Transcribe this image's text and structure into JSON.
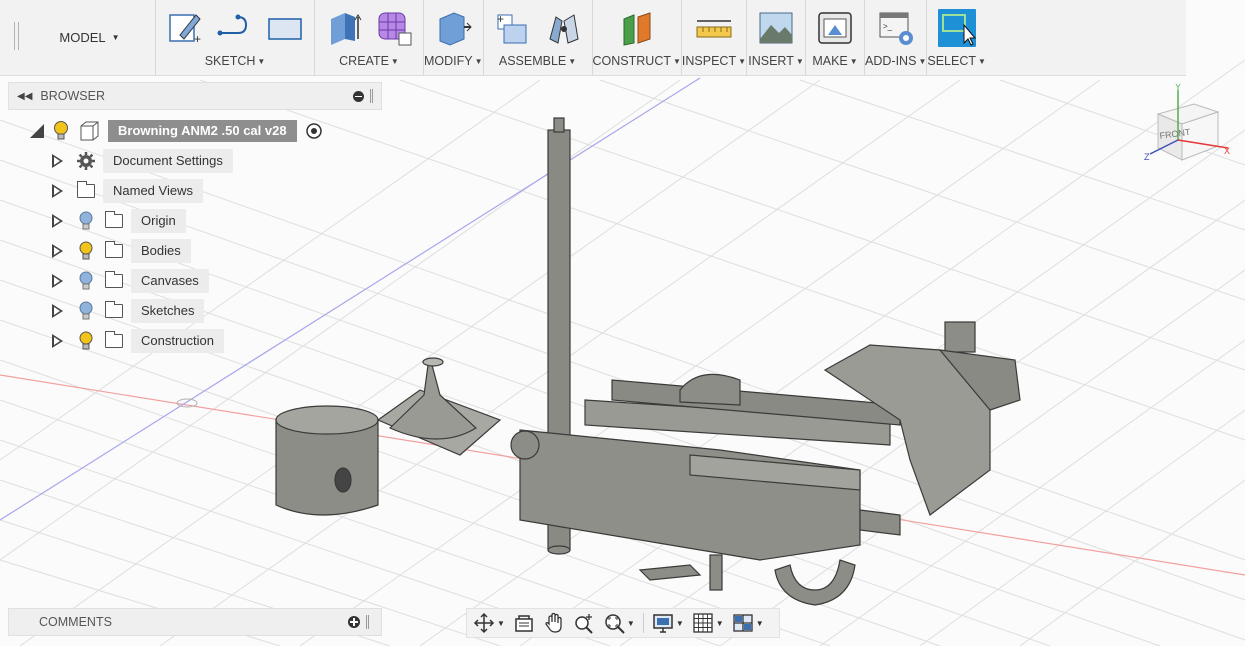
{
  "toolbar": {
    "workspace": "MODEL",
    "groups": [
      {
        "label": "SKETCH"
      },
      {
        "label": "CREATE"
      },
      {
        "label": "MODIFY"
      },
      {
        "label": "ASSEMBLE"
      },
      {
        "label": "CONSTRUCT"
      },
      {
        "label": "INSPECT"
      },
      {
        "label": "INSERT"
      },
      {
        "label": "MAKE"
      },
      {
        "label": "ADD-INS"
      },
      {
        "label": "SELECT"
      }
    ]
  },
  "browser": {
    "title": "BROWSER",
    "root": "Browning ANM2 .50 cal v28",
    "items": [
      {
        "label": "Document Settings",
        "icon": "gear-icon"
      },
      {
        "label": "Named Views",
        "icon": "folder-icon"
      },
      {
        "label": "Origin",
        "icon": "folder-icon",
        "bulb": "off"
      },
      {
        "label": "Bodies",
        "icon": "folder-icon",
        "bulb": "on"
      },
      {
        "label": "Canvases",
        "icon": "folder-icon",
        "bulb": "off"
      },
      {
        "label": "Sketches",
        "icon": "folder-icon",
        "bulb": "off"
      },
      {
        "label": "Construction",
        "icon": "folder-icon",
        "bulb": "on"
      }
    ]
  },
  "comments": {
    "title": "COMMENTS"
  },
  "viewcube": {
    "face": "FRONT",
    "axes": [
      "X",
      "Y",
      "Z"
    ]
  },
  "colors": {
    "accent": "#1e90d6",
    "bulb_on": "#f2c318",
    "bulb_off": "#8fb3dc",
    "model": "#8b8b85"
  }
}
